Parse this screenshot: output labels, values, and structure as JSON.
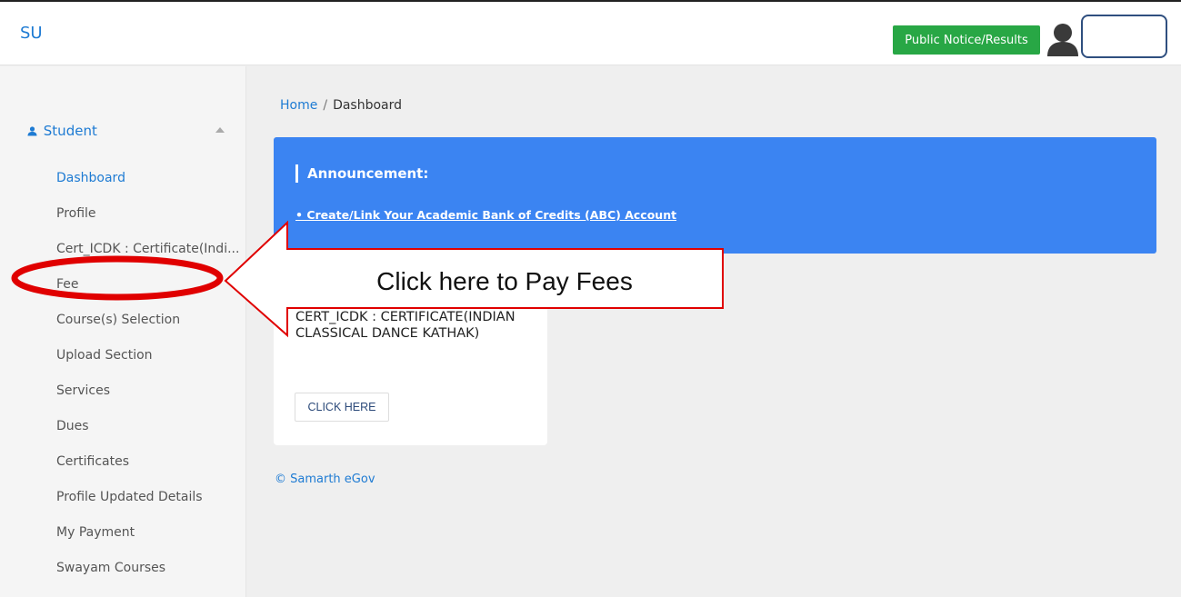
{
  "navbar": {
    "brand": "SU",
    "public_notice_label": "Public Notice/Results",
    "user_name": ""
  },
  "sidebar": {
    "section_label": "Student",
    "items": [
      {
        "label": "Dashboard",
        "active": true
      },
      {
        "label": "Profile"
      },
      {
        "label": "Cert_ICDK : Certificate(Indi..."
      },
      {
        "label": "Fee"
      },
      {
        "label": "Course(s) Selection"
      },
      {
        "label": "Upload Section"
      },
      {
        "label": "Services"
      },
      {
        "label": "Dues"
      },
      {
        "label": "Certificates"
      },
      {
        "label": "Profile Updated Details"
      },
      {
        "label": "My Payment"
      },
      {
        "label": "Swayam Courses"
      }
    ]
  },
  "breadcrumb": {
    "home": "Home",
    "separator": "/",
    "current": "Dashboard"
  },
  "announcement": {
    "title": "Announcement:",
    "link": "• Create/Link Your Academic Bank of Credits (ABC) Account"
  },
  "course_card": {
    "name": "CERT_ICDK : CERTIFICATE(INDIAN CLASSICAL DANCE KATHAK)",
    "button_label": "CLICK HERE"
  },
  "footer": {
    "text": "© Samarth eGov"
  },
  "callout": {
    "text": "Click here to Pay Fees"
  },
  "colors": {
    "primary": "#1e7bd3",
    "announcement_bg": "#3b84f2",
    "notice_button": "#28a745",
    "callout_red": "#e00000"
  }
}
